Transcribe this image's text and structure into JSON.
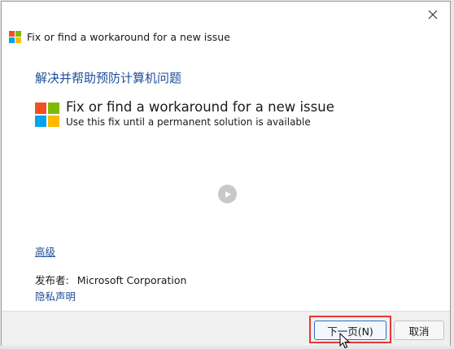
{
  "window": {
    "title": "Fix or find a workaround for a new issue",
    "close_icon": "close-icon"
  },
  "logo_colors": [
    "#f25022",
    "#7fba00",
    "#00a4ef",
    "#ffb900"
  ],
  "main": {
    "heading": "解决并帮助预防计算机问题",
    "fix_title": "Fix or find a workaround for a new issue",
    "fix_subtitle": "Use this fix until a permanent solution is available",
    "play_icon": "play-icon",
    "advanced_link": "高级",
    "publisher_label": "发布者:",
    "publisher_value": "Microsoft Corporation",
    "privacy_link": "隐私声明"
  },
  "footer": {
    "next_label": "下一页(N)",
    "cancel_label": "取消",
    "highlight_color": "#e53935"
  }
}
